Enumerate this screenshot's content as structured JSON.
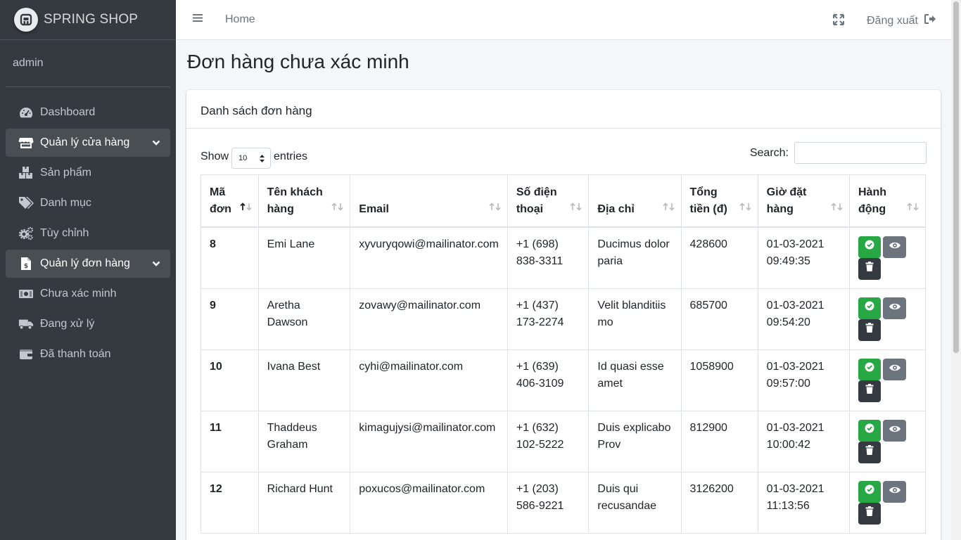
{
  "brand": {
    "name": "SPRING SHOP"
  },
  "user": {
    "name": "admin"
  },
  "sidebar": {
    "items": [
      {
        "label": "Dashboard",
        "icon": "tachometer-icon"
      },
      {
        "label": "Quản lý cửa hàng",
        "icon": "store-icon",
        "expanded": true
      },
      {
        "label": "Sản phẩm",
        "icon": "boxes-icon"
      },
      {
        "label": "Danh mục",
        "icon": "tags-icon"
      },
      {
        "label": "Tùy chỉnh",
        "icon": "cogs-icon"
      },
      {
        "label": "Quản lý đơn hàng",
        "icon": "invoice-icon",
        "expanded": true
      },
      {
        "label": "Chưa xác minh",
        "icon": "money-bill-icon"
      },
      {
        "label": "Đang xử lý",
        "icon": "truck-icon"
      },
      {
        "label": "Đã thanh toán",
        "icon": "wallet-icon"
      }
    ]
  },
  "topnav": {
    "home_label": "Home",
    "logout_label": "Đăng xuất"
  },
  "page": {
    "title": "Đơn hàng chưa xác minh"
  },
  "card": {
    "title": "Danh sách đơn hàng"
  },
  "controls": {
    "show_label": "Show",
    "entries_value": "10",
    "entries_label": "entries",
    "search_label": "Search:",
    "search_value": ""
  },
  "table": {
    "headers": {
      "id": "Mã đơn",
      "customer": "Tên khách hàng",
      "email": "Email",
      "phone": "Số điện thoại",
      "address": "Địa chỉ",
      "total": "Tổng tiền (đ)",
      "time": "Giờ đặt hàng",
      "actions": "Hành động"
    },
    "rows": [
      {
        "id": "8",
        "customer": "Emi Lane",
        "email": "xyvuryqowi@mailinator.com",
        "phone": "+1 (698) 838-3311",
        "address": "Ducimus dolor paria",
        "total": "428600",
        "time": "01-03-2021 09:49:35"
      },
      {
        "id": "9",
        "customer": "Aretha Dawson",
        "email": "zovawy@mailinator.com",
        "phone": "+1 (437) 173-2274",
        "address": "Velit blanditiis mo",
        "total": "685700",
        "time": "01-03-2021 09:54:20"
      },
      {
        "id": "10",
        "customer": "Ivana Best",
        "email": "cyhi@mailinator.com",
        "phone": "+1 (639) 406-3109",
        "address": "Id quasi esse amet",
        "total": "1058900",
        "time": "01-03-2021 09:57:00"
      },
      {
        "id": "11",
        "customer": "Thaddeus Graham",
        "email": "kimagujysi@mailinator.com",
        "phone": "+1 (632) 102-5222",
        "address": "Duis explicabo Prov",
        "total": "812900",
        "time": "01-03-2021 10:00:42"
      },
      {
        "id": "12",
        "customer": "Richard Hunt",
        "email": "poxucos@mailinator.com",
        "phone": "+1 (203) 586-9221",
        "address": "Duis qui recusandae",
        "total": "3126200",
        "time": "01-03-2021 11:13:56"
      }
    ]
  },
  "colors": {
    "sidebar": "#343a40",
    "success": "#28a745",
    "secondary": "#6c757d",
    "dark": "#343a40"
  }
}
